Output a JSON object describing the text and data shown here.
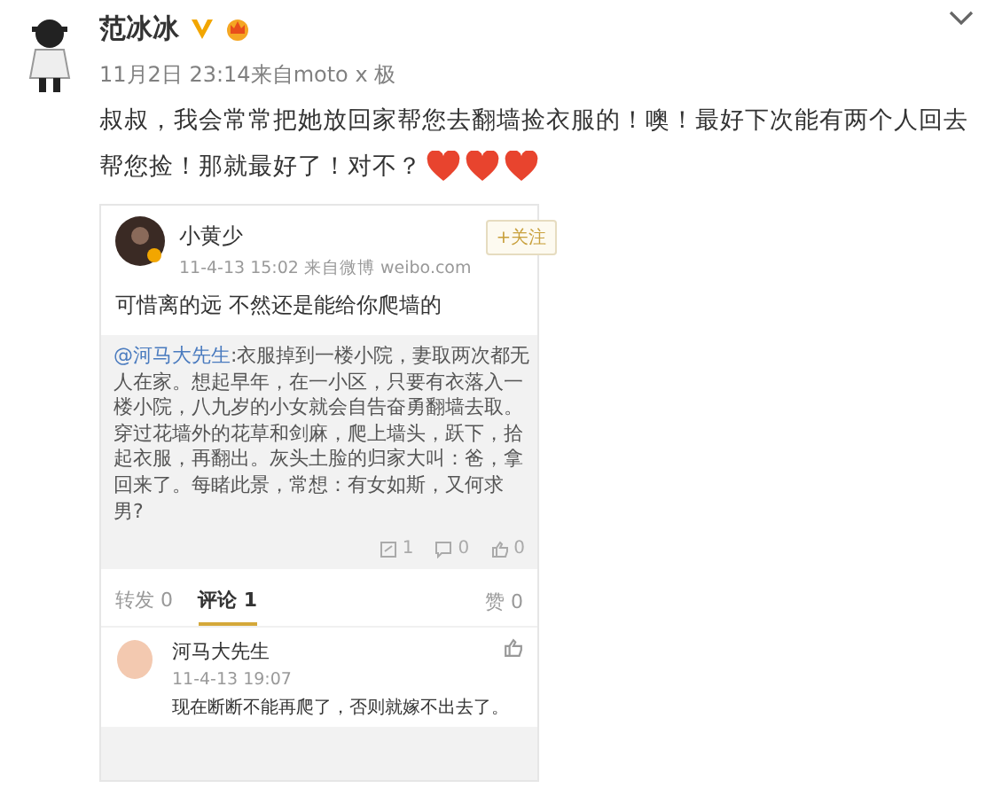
{
  "post": {
    "author": "范冰冰",
    "verified": true,
    "time": "11月2日 23:14",
    "source": "来自moto x 极",
    "text": "叔叔，我会常常把她放回家帮您去翻墙捡衣服的！噢！最好下次能有两个人回去帮您捡！那就最好了！对不？",
    "emojis": [
      {
        "kind": "heart"
      },
      {
        "kind": "heart"
      },
      {
        "kind": "heart"
      }
    ]
  },
  "card": {
    "author": "小黄少",
    "meta": "11-4-13 15:02  来自微博 weibo.com",
    "follow": "+关注",
    "text": "可惜离的远 不然还是能给你爬墙的",
    "quote": {
      "mention": "@河马大先生",
      "text": ":衣服掉到一楼小院，妻取两次都无人在家。想起早年，在一小区，只要有衣落入一楼小院，八九岁的小女就会自告奋勇翻墙去取。穿过花墙外的花草和剑麻，爬上墙头，跃下，拾起衣服，再翻出。灰头土脸的归家大叫：爸，拿回来了。每睹此景，常想：有女如斯，又何求男?",
      "stats": [
        {
          "kind": "repost",
          "count": "1"
        },
        {
          "kind": "comment",
          "count": "0"
        },
        {
          "kind": "like",
          "count": "0"
        }
      ]
    },
    "tabs": [
      {
        "label": "转发 0",
        "selected": false
      },
      {
        "label": "评论 1",
        "selected": true
      }
    ],
    "likes": "赞 0",
    "comments": [
      {
        "author": "河马大先生",
        "time": "11-4-13 19:07",
        "text": "现在断断不能再爬了，否则就嫁不出去了。"
      }
    ]
  }
}
